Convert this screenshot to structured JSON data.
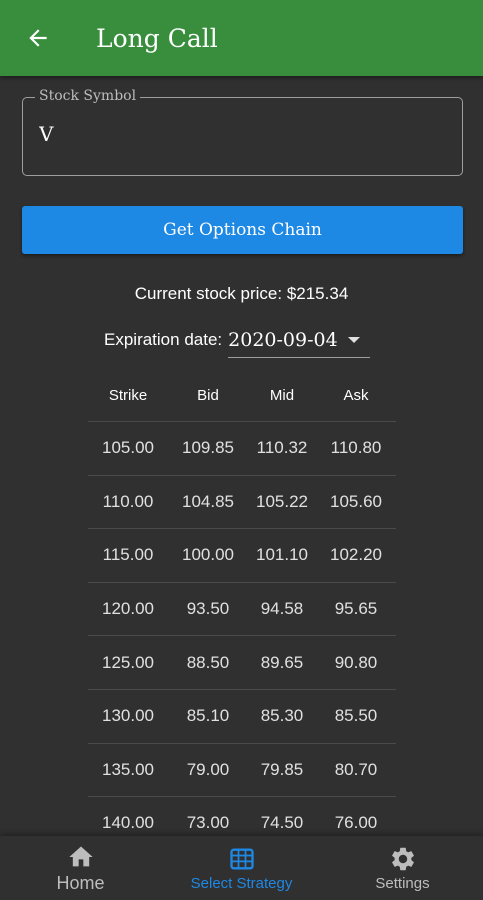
{
  "app_bar": {
    "title": "Long Call",
    "back_icon": "arrow-left-icon"
  },
  "form": {
    "stock_symbol_label": "Stock Symbol",
    "stock_symbol_value": "V",
    "get_chain_label": "Get Options Chain"
  },
  "price": {
    "text": "Current stock price: $215.34"
  },
  "expiration": {
    "label": "Expiration date:",
    "value": "2020-09-04"
  },
  "table": {
    "headers": [
      "Strike",
      "Bid",
      "Mid",
      "Ask"
    ],
    "rows": [
      [
        "105.00",
        "109.85",
        "110.32",
        "110.80"
      ],
      [
        "110.00",
        "104.85",
        "105.22",
        "105.60"
      ],
      [
        "115.00",
        "100.00",
        "101.10",
        "102.20"
      ],
      [
        "120.00",
        "93.50",
        "94.58",
        "95.65"
      ],
      [
        "125.00",
        "88.50",
        "89.65",
        "90.80"
      ],
      [
        "130.00",
        "85.10",
        "85.30",
        "85.50"
      ],
      [
        "135.00",
        "79.00",
        "79.85",
        "80.70"
      ],
      [
        "140.00",
        "73.00",
        "74.50",
        "76.00"
      ]
    ]
  },
  "bottom_nav": {
    "items": [
      {
        "label": "Home",
        "icon": "home-icon",
        "active": false
      },
      {
        "label": "Select Strategy",
        "icon": "strategy-grid-icon",
        "active": true
      },
      {
        "label": "Settings",
        "icon": "gear-icon",
        "active": false
      }
    ]
  },
  "colors": {
    "app_bar": "#388e3c",
    "accent": "#1e88e5",
    "background": "#303030"
  }
}
